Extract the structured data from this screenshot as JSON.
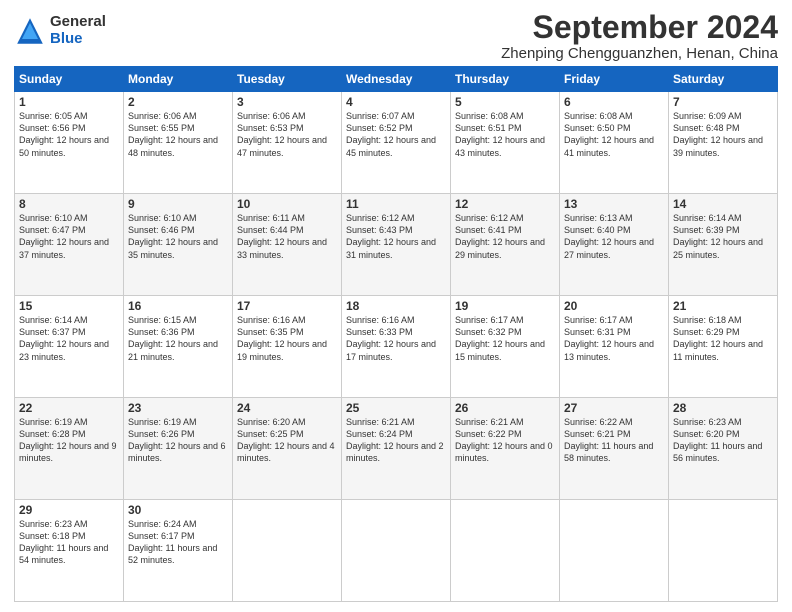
{
  "logo": {
    "general": "General",
    "blue": "Blue"
  },
  "title": "September 2024",
  "location": "Zhenping Chengguanzhen, Henan, China",
  "headers": [
    "Sunday",
    "Monday",
    "Tuesday",
    "Wednesday",
    "Thursday",
    "Friday",
    "Saturday"
  ],
  "weeks": [
    [
      {
        "day": "1",
        "sunrise": "Sunrise: 6:05 AM",
        "sunset": "Sunset: 6:56 PM",
        "daylight": "Daylight: 12 hours and 50 minutes."
      },
      {
        "day": "2",
        "sunrise": "Sunrise: 6:06 AM",
        "sunset": "Sunset: 6:55 PM",
        "daylight": "Daylight: 12 hours and 48 minutes."
      },
      {
        "day": "3",
        "sunrise": "Sunrise: 6:06 AM",
        "sunset": "Sunset: 6:53 PM",
        "daylight": "Daylight: 12 hours and 47 minutes."
      },
      {
        "day": "4",
        "sunrise": "Sunrise: 6:07 AM",
        "sunset": "Sunset: 6:52 PM",
        "daylight": "Daylight: 12 hours and 45 minutes."
      },
      {
        "day": "5",
        "sunrise": "Sunrise: 6:08 AM",
        "sunset": "Sunset: 6:51 PM",
        "daylight": "Daylight: 12 hours and 43 minutes."
      },
      {
        "day": "6",
        "sunrise": "Sunrise: 6:08 AM",
        "sunset": "Sunset: 6:50 PM",
        "daylight": "Daylight: 12 hours and 41 minutes."
      },
      {
        "day": "7",
        "sunrise": "Sunrise: 6:09 AM",
        "sunset": "Sunset: 6:48 PM",
        "daylight": "Daylight: 12 hours and 39 minutes."
      }
    ],
    [
      {
        "day": "8",
        "sunrise": "Sunrise: 6:10 AM",
        "sunset": "Sunset: 6:47 PM",
        "daylight": "Daylight: 12 hours and 37 minutes."
      },
      {
        "day": "9",
        "sunrise": "Sunrise: 6:10 AM",
        "sunset": "Sunset: 6:46 PM",
        "daylight": "Daylight: 12 hours and 35 minutes."
      },
      {
        "day": "10",
        "sunrise": "Sunrise: 6:11 AM",
        "sunset": "Sunset: 6:44 PM",
        "daylight": "Daylight: 12 hours and 33 minutes."
      },
      {
        "day": "11",
        "sunrise": "Sunrise: 6:12 AM",
        "sunset": "Sunset: 6:43 PM",
        "daylight": "Daylight: 12 hours and 31 minutes."
      },
      {
        "day": "12",
        "sunrise": "Sunrise: 6:12 AM",
        "sunset": "Sunset: 6:41 PM",
        "daylight": "Daylight: 12 hours and 29 minutes."
      },
      {
        "day": "13",
        "sunrise": "Sunrise: 6:13 AM",
        "sunset": "Sunset: 6:40 PM",
        "daylight": "Daylight: 12 hours and 27 minutes."
      },
      {
        "day": "14",
        "sunrise": "Sunrise: 6:14 AM",
        "sunset": "Sunset: 6:39 PM",
        "daylight": "Daylight: 12 hours and 25 minutes."
      }
    ],
    [
      {
        "day": "15",
        "sunrise": "Sunrise: 6:14 AM",
        "sunset": "Sunset: 6:37 PM",
        "daylight": "Daylight: 12 hours and 23 minutes."
      },
      {
        "day": "16",
        "sunrise": "Sunrise: 6:15 AM",
        "sunset": "Sunset: 6:36 PM",
        "daylight": "Daylight: 12 hours and 21 minutes."
      },
      {
        "day": "17",
        "sunrise": "Sunrise: 6:16 AM",
        "sunset": "Sunset: 6:35 PM",
        "daylight": "Daylight: 12 hours and 19 minutes."
      },
      {
        "day": "18",
        "sunrise": "Sunrise: 6:16 AM",
        "sunset": "Sunset: 6:33 PM",
        "daylight": "Daylight: 12 hours and 17 minutes."
      },
      {
        "day": "19",
        "sunrise": "Sunrise: 6:17 AM",
        "sunset": "Sunset: 6:32 PM",
        "daylight": "Daylight: 12 hours and 15 minutes."
      },
      {
        "day": "20",
        "sunrise": "Sunrise: 6:17 AM",
        "sunset": "Sunset: 6:31 PM",
        "daylight": "Daylight: 12 hours and 13 minutes."
      },
      {
        "day": "21",
        "sunrise": "Sunrise: 6:18 AM",
        "sunset": "Sunset: 6:29 PM",
        "daylight": "Daylight: 12 hours and 11 minutes."
      }
    ],
    [
      {
        "day": "22",
        "sunrise": "Sunrise: 6:19 AM",
        "sunset": "Sunset: 6:28 PM",
        "daylight": "Daylight: 12 hours and 9 minutes."
      },
      {
        "day": "23",
        "sunrise": "Sunrise: 6:19 AM",
        "sunset": "Sunset: 6:26 PM",
        "daylight": "Daylight: 12 hours and 6 minutes."
      },
      {
        "day": "24",
        "sunrise": "Sunrise: 6:20 AM",
        "sunset": "Sunset: 6:25 PM",
        "daylight": "Daylight: 12 hours and 4 minutes."
      },
      {
        "day": "25",
        "sunrise": "Sunrise: 6:21 AM",
        "sunset": "Sunset: 6:24 PM",
        "daylight": "Daylight: 12 hours and 2 minutes."
      },
      {
        "day": "26",
        "sunrise": "Sunrise: 6:21 AM",
        "sunset": "Sunset: 6:22 PM",
        "daylight": "Daylight: 12 hours and 0 minutes."
      },
      {
        "day": "27",
        "sunrise": "Sunrise: 6:22 AM",
        "sunset": "Sunset: 6:21 PM",
        "daylight": "Daylight: 11 hours and 58 minutes."
      },
      {
        "day": "28",
        "sunrise": "Sunrise: 6:23 AM",
        "sunset": "Sunset: 6:20 PM",
        "daylight": "Daylight: 11 hours and 56 minutes."
      }
    ],
    [
      {
        "day": "29",
        "sunrise": "Sunrise: 6:23 AM",
        "sunset": "Sunset: 6:18 PM",
        "daylight": "Daylight: 11 hours and 54 minutes."
      },
      {
        "day": "30",
        "sunrise": "Sunrise: 6:24 AM",
        "sunset": "Sunset: 6:17 PM",
        "daylight": "Daylight: 11 hours and 52 minutes."
      },
      null,
      null,
      null,
      null,
      null
    ]
  ]
}
